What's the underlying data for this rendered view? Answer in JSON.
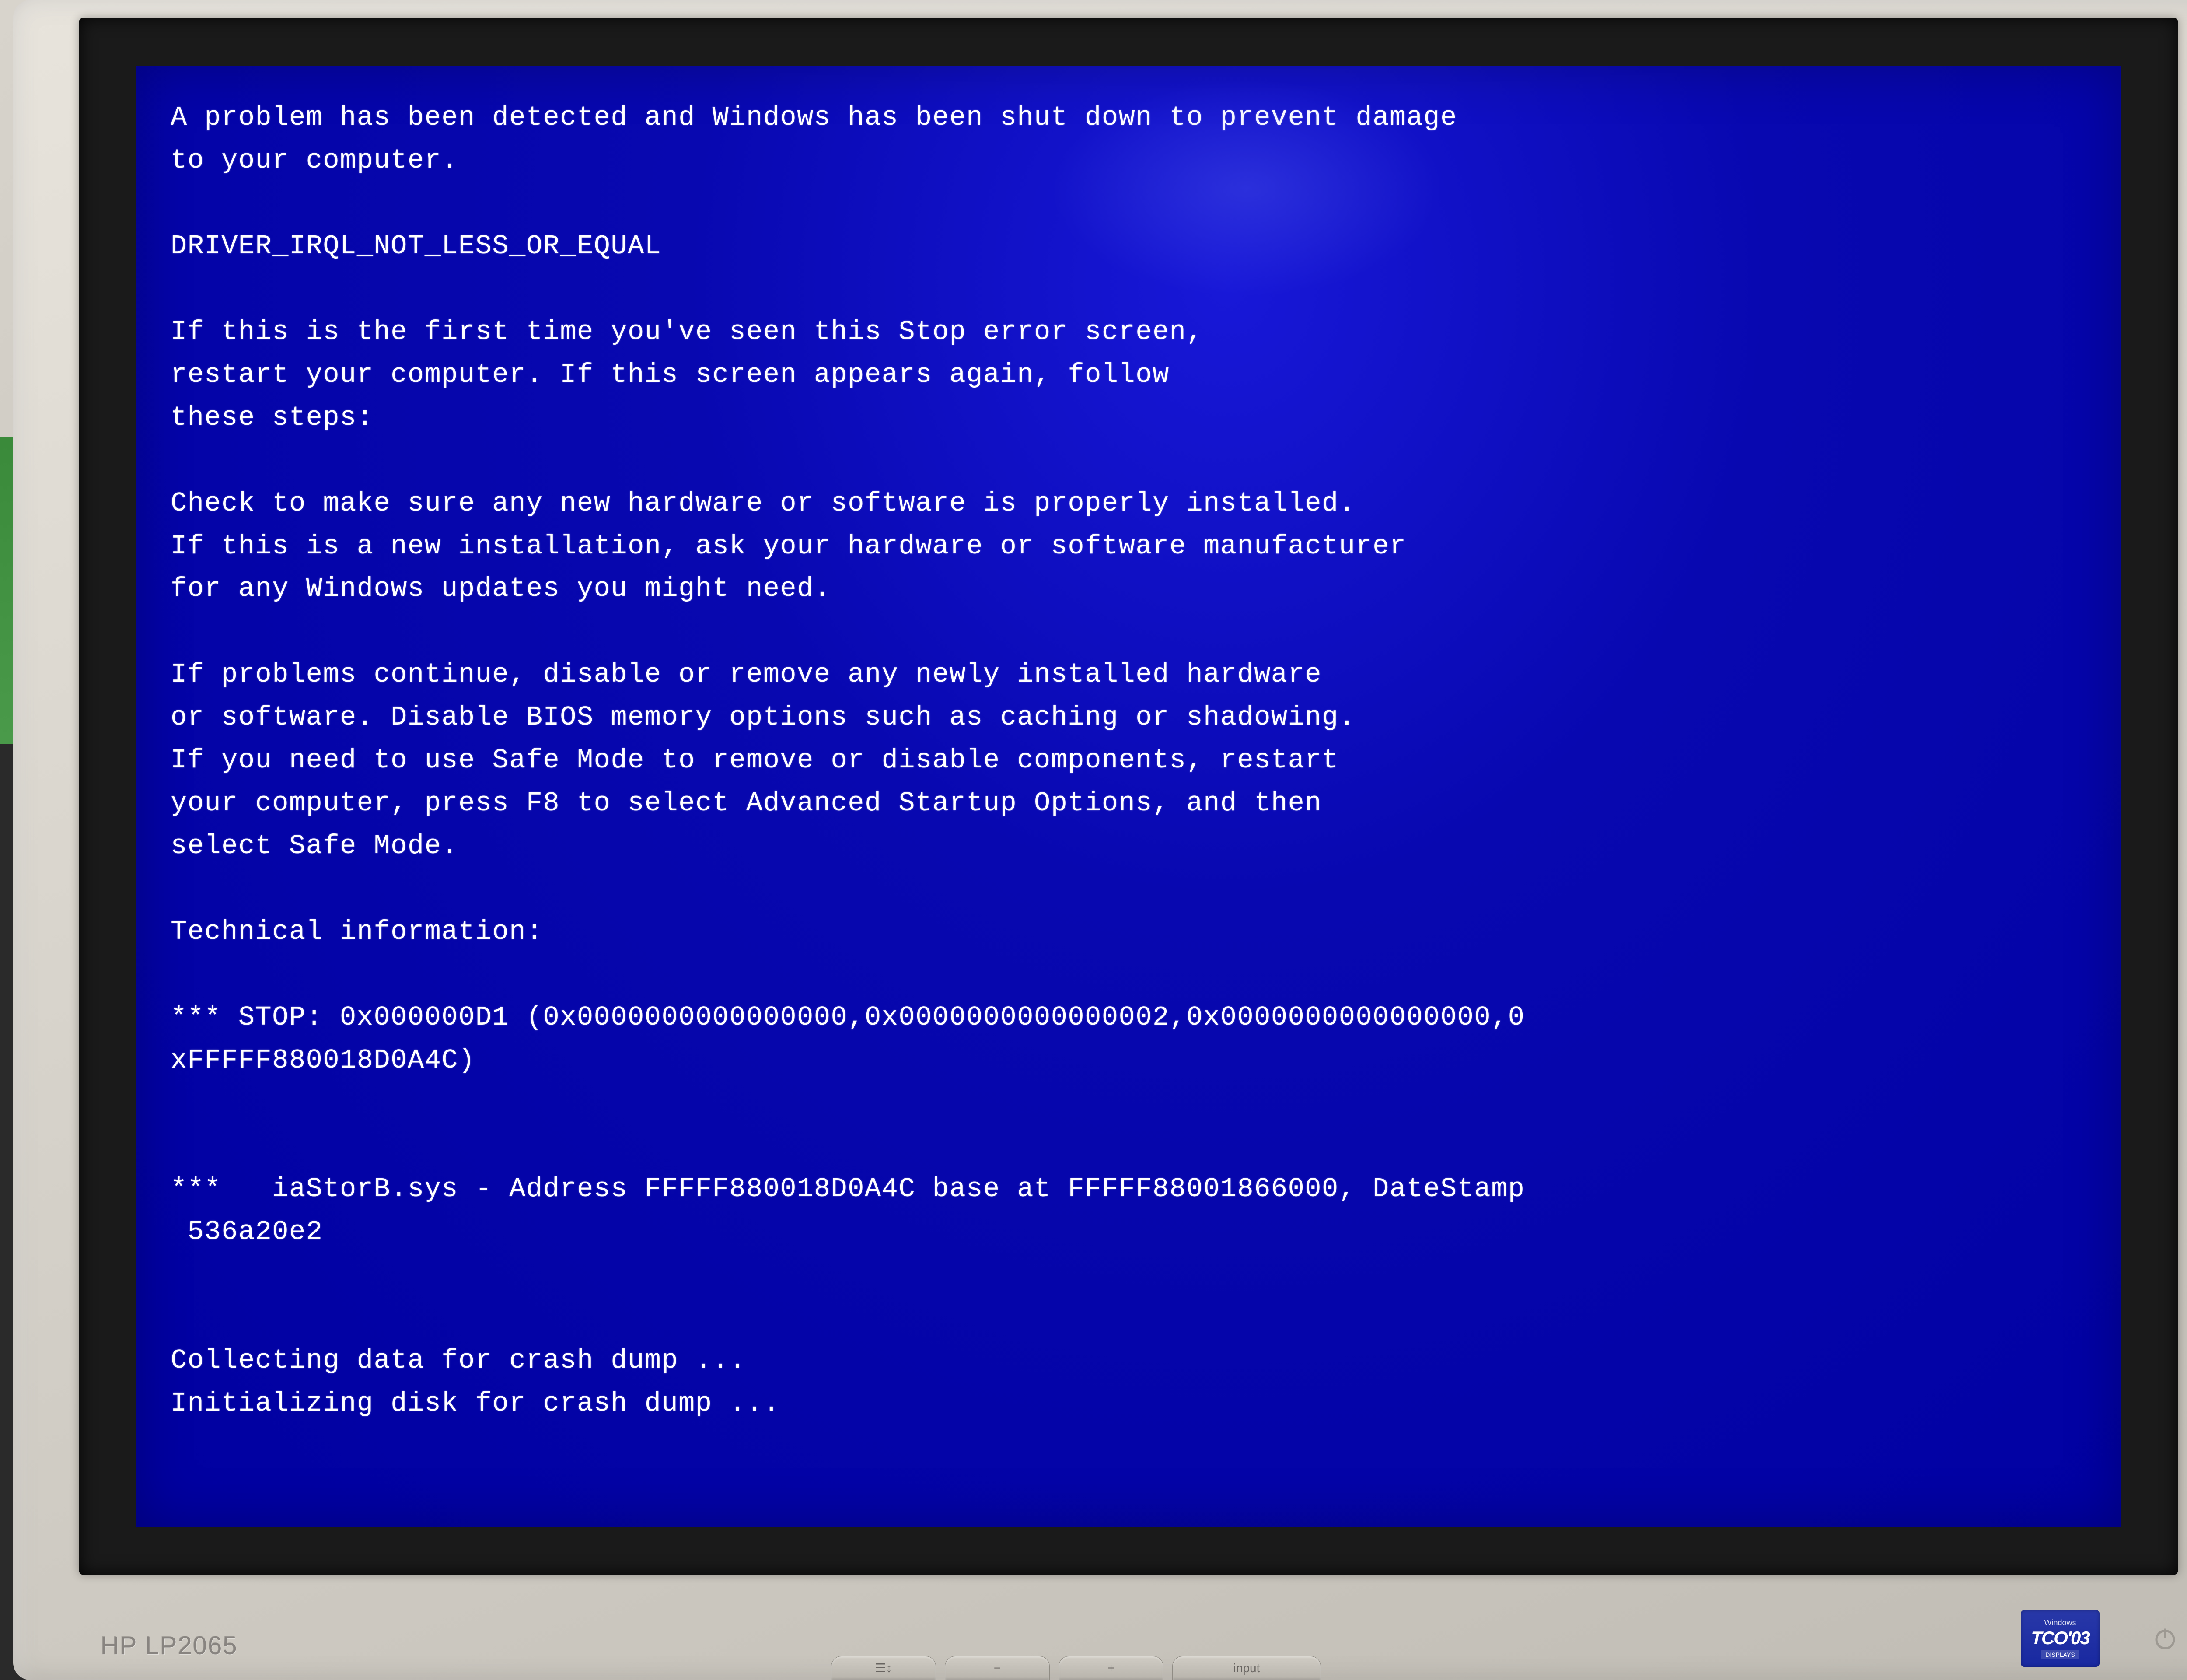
{
  "bsod": {
    "intro_line1": "A problem has been detected and Windows has been shut down to prevent damage",
    "intro_line2": "to your computer.",
    "error_code": "DRIVER_IRQL_NOT_LESS_OR_EQUAL",
    "first_time_line1": "If this is the first time you've seen this Stop error screen,",
    "first_time_line2": "restart your computer. If this screen appears again, follow",
    "first_time_line3": "these steps:",
    "check_line1": "Check to make sure any new hardware or software is properly installed.",
    "check_line2": "If this is a new installation, ask your hardware or software manufacturer",
    "check_line3": "for any Windows updates you might need.",
    "problems_line1": "If problems continue, disable or remove any newly installed hardware",
    "problems_line2": "or software. Disable BIOS memory options such as caching or shadowing.",
    "problems_line3": "If you need to use Safe Mode to remove or disable components, restart",
    "problems_line4": "your computer, press F8 to select Advanced Startup Options, and then",
    "problems_line5": "select Safe Mode.",
    "tech_header": "Technical information:",
    "stop_line1": "*** STOP: 0x000000D1 (0x0000000000000000,0x0000000000000002,0x0000000000000000,0",
    "stop_line2": "xFFFFF880018D0A4C)",
    "driver_line1": "***   iaStorB.sys - Address FFFFF880018D0A4C base at FFFFF88001866000, DateStamp",
    "driver_line2": " 536a20e2",
    "collecting": "Collecting data for crash dump ...",
    "initializing": "Initializing disk for crash dump ..."
  },
  "monitor": {
    "model_label": "HP LP2065",
    "button_minus": "−",
    "button_plus": "+",
    "button_input": "input",
    "badge_top": "Windows",
    "badge_main": "TCO'03",
    "badge_bottom": "DISPLAYS"
  }
}
